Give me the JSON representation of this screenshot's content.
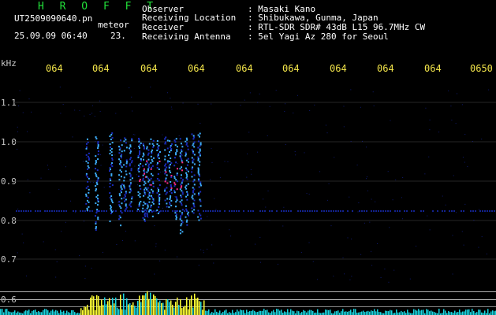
{
  "header": {
    "app_title": "H R O F F T",
    "filename": "UT2509090640.pn",
    "meteor_label": "meteor",
    "datetime": "25.09.09 06:40",
    "count": "23."
  },
  "info": {
    "observer_label": "Observer",
    "observer_value": ": Masaki Kano",
    "location_label": "Receiving Location",
    "location_value": ": Shibukawa, Gunma, Japan",
    "receiver_label": "Receiver",
    "receiver_value": ": RTL-SDR SDR# 43dB L15 96.7MHz CW",
    "antenna_label": "Receiving Antenna",
    "antenna_value": ": 5el Yagi Az 280 for Seoul"
  },
  "axis": {
    "unit": "kHz",
    "y_ticks": [
      "1.1",
      "1.0",
      "0.9",
      "0.8",
      "0.7",
      "0.6"
    ],
    "x_ticks": [
      "064",
      "064",
      "064",
      "064",
      "064",
      "064",
      "064",
      "064",
      "064",
      "0650"
    ]
  },
  "colors": {
    "background": "#000000",
    "title": "#22e03a",
    "time_labels": "#f2e44a",
    "signal_peak": "#ffff33",
    "signal_base": "#19d6e0",
    "echo_core": "#ff2e8a",
    "echo_mid": "#3fb0ff",
    "echo_low": "#1a2dbf"
  }
}
